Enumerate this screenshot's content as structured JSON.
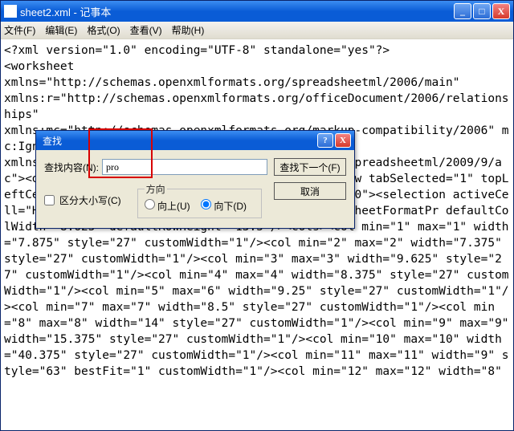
{
  "window": {
    "title": "sheet2.xml - 记事本",
    "minimize_icon": "_",
    "maximize_icon": "□",
    "close_icon": "X"
  },
  "menu": {
    "file": "文件(F)",
    "edit": "编辑(E)",
    "format": "格式(O)",
    "view": "查看(V)",
    "help": "帮助(H)"
  },
  "content_text": "<?xml version=\"1.0\" encoding=\"UTF-8\" standalone=\"yes\"?>\n<worksheet\nxmlns=\"http://schemas.openxmlformats.org/spreadsheetml/2006/main\"\nxmlns:r=\"http://schemas.openxmlformats.org/officeDocument/2006/relationships\"\nxmlns:mc=\"http://schemas.openxmlformats.org/markup-compatibility/2006\" mc:Ignorable=\"x14ac\"\nxmlns:x14ac=\"http://schemas.microsoft.com/office/spreadsheetml/2009/9/ac\"><dimension ref=\"A1:AJ13\"/><sheetViews><sheetView tabSelected=\"1\" topLeftCell=\"H1\" zoomScaleNormal=\"80\" workbookViewId=\"0\"><selection activeCell=\"H3\" sqref=\"H3:I3\"/></sheetView></sheetViews><sheetFormatPr defaultColWidth=\"8.625\" defaultRowHeight=\"13.5\"/><cols><col min=\"1\" max=\"1\" width=\"7.875\" style=\"27\" customWidth=\"1\"/><col min=\"2\" max=\"2\" width=\"7.375\" style=\"27\" customWidth=\"1\"/><col min=\"3\" max=\"3\" width=\"9.625\" style=\"27\" customWidth=\"1\"/><col min=\"4\" max=\"4\" width=\"8.375\" style=\"27\" customWidth=\"1\"/><col min=\"5\" max=\"6\" width=\"9.25\" style=\"27\" customWidth=\"1\"/><col min=\"7\" max=\"7\" width=\"8.5\" style=\"27\" customWidth=\"1\"/><col min=\"8\" max=\"8\" width=\"14\" style=\"27\" customWidth=\"1\"/><col min=\"9\" max=\"9\" width=\"15.375\" style=\"27\" customWidth=\"1\"/><col min=\"10\" max=\"10\" width=\"40.375\" style=\"27\" customWidth=\"1\"/><col min=\"11\" max=\"11\" width=\"9\" style=\"63\" bestFit=\"1\" customWidth=\"1\"/><col min=\"12\" max=\"12\" width=\"8\"",
  "find_dialog": {
    "title": "查找",
    "help_icon": "?",
    "close_icon": "X",
    "label": "查找内容(N):",
    "value": "pro",
    "find_next": "查找下一个(F)",
    "cancel": "取消",
    "match_case": "区分大小写(C)",
    "direction_legend": "方向",
    "up": "向上(U)",
    "down": "向下(D)"
  }
}
